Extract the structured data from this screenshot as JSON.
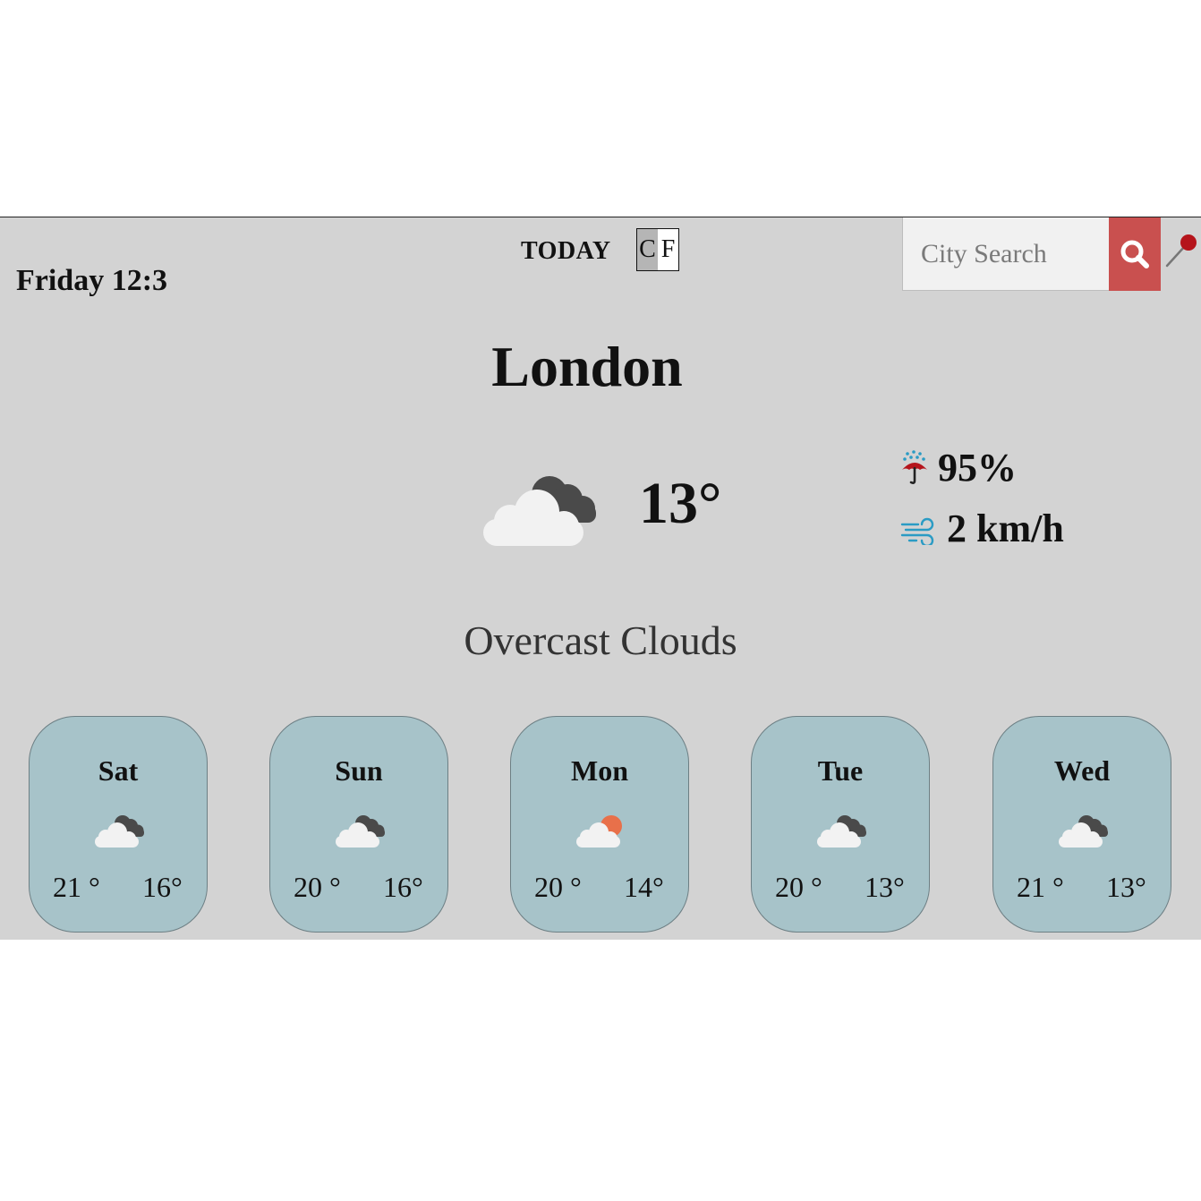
{
  "header": {
    "datetime": "Friday 12:3",
    "today_label": "TODAY",
    "unit_celsius": "C",
    "unit_fahrenheit": "F",
    "search_placeholder": "City Search",
    "search_icon": "search-icon",
    "location_icon": "map-pin-icon"
  },
  "current": {
    "city": "London",
    "icon": "overcast-clouds-icon",
    "temperature": "13°",
    "humidity_icon": "umbrella-rain-icon",
    "humidity": "95%",
    "wind_icon": "wind-icon",
    "wind": "2 km/h",
    "description": "Overcast Clouds"
  },
  "forecast": [
    {
      "day": "Sat",
      "icon": "overcast-clouds-icon",
      "high": "21 °",
      "low": "16°"
    },
    {
      "day": "Sun",
      "icon": "overcast-clouds-icon",
      "high": "20 °",
      "low": "16°"
    },
    {
      "day": "Mon",
      "icon": "partly-cloudy-sun-icon",
      "high": "20 °",
      "low": "14°"
    },
    {
      "day": "Tue",
      "icon": "overcast-clouds-icon",
      "high": "20 °",
      "low": "13°"
    },
    {
      "day": "Wed",
      "icon": "overcast-clouds-icon",
      "high": "21 °",
      "low": "13°"
    }
  ],
  "colors": {
    "panel_background": "#d3d3d3",
    "card_background": "#a7c3c9",
    "search_button": "#c9504f",
    "unit_selected": "#b5b5b5",
    "sun": "#e8704a",
    "dark_cloud": "#4a4a4a",
    "light_cloud": "#f2f2f2"
  }
}
